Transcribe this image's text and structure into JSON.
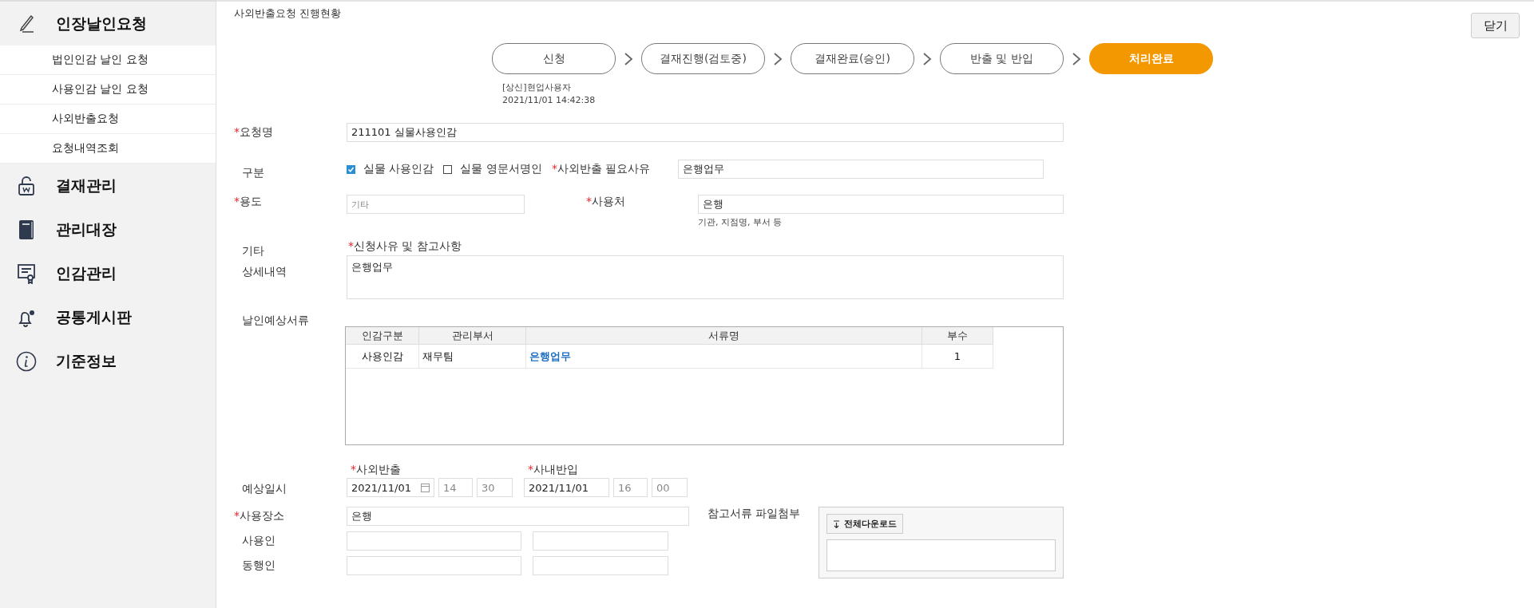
{
  "sidebar": {
    "items": [
      {
        "label": "인장날인요청",
        "children": [
          {
            "label": "법인인감 날인 요청"
          },
          {
            "label": "사용인감 날인 요청"
          },
          {
            "label": "사외반출요청"
          },
          {
            "label": "요청내역조회"
          }
        ]
      },
      {
        "label": "결재관리"
      },
      {
        "label": "관리대장"
      },
      {
        "label": "인감관리"
      },
      {
        "label": "공통게시판"
      },
      {
        "label": "기준정보"
      }
    ]
  },
  "page_title": "사외반출요청 진행현황",
  "close_button": "닫기",
  "steps": [
    {
      "label": "신청",
      "selected": false
    },
    {
      "label": "결재진행(검토중)",
      "selected": false
    },
    {
      "label": "결재완료(승인)",
      "selected": false
    },
    {
      "label": "반출 및 반입",
      "selected": false
    },
    {
      "label": "처리완료",
      "selected": true
    }
  ],
  "step_note": [
    "[상신]현업사용자",
    "2021/11/01 14:42:38"
  ],
  "request_name": {
    "mark": "*",
    "label": "요청명",
    "value": "211101 실물사용인감"
  },
  "category": {
    "label": "구분",
    "options": [
      {
        "label": "실물 사용인감",
        "checked": true
      },
      {
        "label": "실물 영문서명인",
        "checked": false
      }
    ]
  },
  "export_reason": {
    "mark": "*",
    "label": "사외반출 필요사유",
    "value": "은행업무"
  },
  "purpose": {
    "mark": "*",
    "label": "용도",
    "placeholder": "기타"
  },
  "use_place": {
    "mark": "*",
    "label": "사용처",
    "value": "은행",
    "hint": "기관, 지점명, 부서 등"
  },
  "details": {
    "label_lines": [
      "기타",
      "상세내역"
    ],
    "mark": "*",
    "sublabel": "신청사유 및 참고사항",
    "value": "은행업무"
  },
  "documents": {
    "label": "날인예상서류",
    "columns": [
      "인감구분",
      "관리부서",
      "서류명",
      "부수"
    ],
    "rows": [
      [
        "사용인감",
        "재무팀",
        "은행업무",
        "1"
      ]
    ]
  },
  "schedule": {
    "label": "예상일시",
    "periods": [
      {
        "mark": "*",
        "label": "사외반출",
        "date": "2021/11/01",
        "hour": "14",
        "minute": "30"
      },
      {
        "mark": "*",
        "label": "사내반입",
        "date": "2021/11/01",
        "hour": "16",
        "minute": "00"
      }
    ]
  },
  "location": {
    "mark": "*",
    "label": "사용장소",
    "value": "은행"
  },
  "people": [
    {
      "label": "사용인"
    },
    {
      "label": "동행인"
    }
  ],
  "attachments": {
    "label": "참고서류 파일첨부",
    "download_button": "전체다운로드"
  }
}
